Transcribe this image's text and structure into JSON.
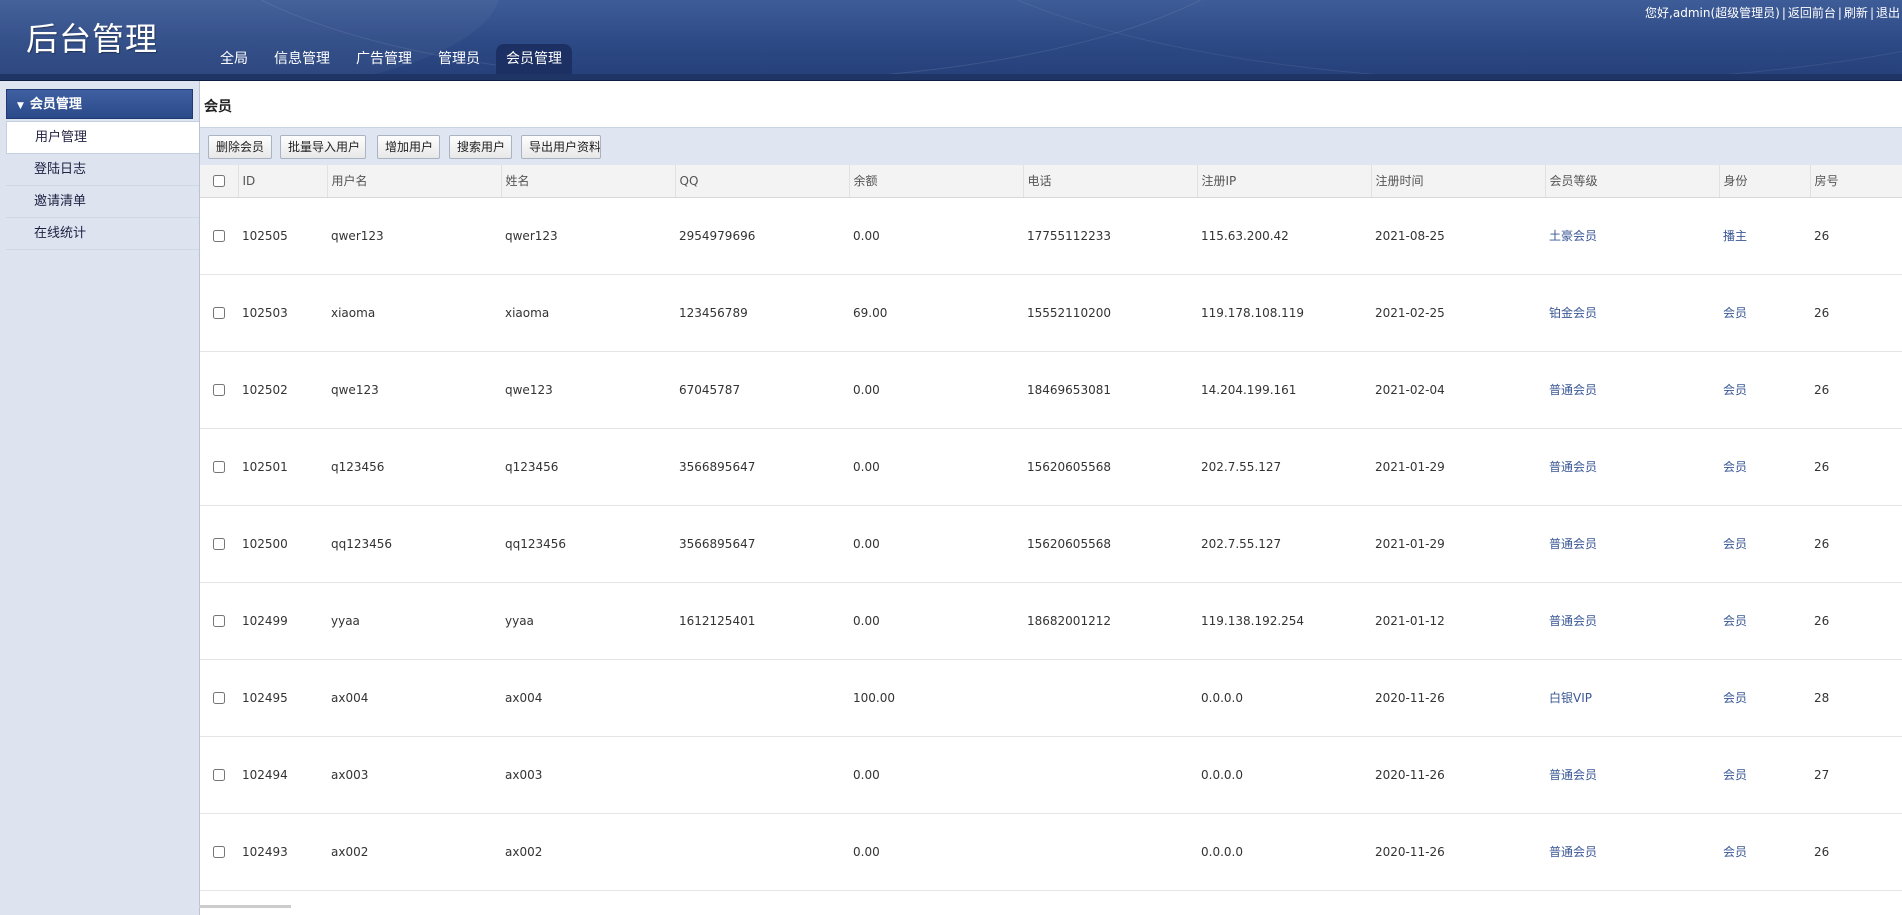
{
  "header": {
    "logo": "后台管理",
    "nav": [
      "全局",
      "信息管理",
      "广告管理",
      "管理员",
      "会员管理"
    ],
    "active_nav": "会员管理",
    "greeting": "您好,admin(超级管理员)",
    "links": [
      "返回前台",
      "刷新",
      "退出"
    ]
  },
  "sidebar": {
    "title": "会员管理",
    "items": [
      "用户管理",
      "登陆日志",
      "邀请清单",
      "在线统计"
    ],
    "active_item": "用户管理"
  },
  "main": {
    "title": "会员",
    "toolbar": [
      "删除会员",
      "批量导入用户",
      "增加用户",
      "搜索用户",
      "导出用户资料"
    ]
  },
  "table": {
    "columns": [
      "ID",
      "用户名",
      "姓名",
      "QQ",
      "余额",
      "电话",
      "注册IP",
      "注册时间",
      "会员等级",
      "身份",
      "房号"
    ],
    "rows": [
      {
        "id": "102505",
        "username": "qwer123",
        "name": "qwer123",
        "qq": "2954979696",
        "balance": "0.00",
        "phone": "17755112233",
        "ip": "115.63.200.42",
        "date": "2021-08-25",
        "level": "土豪会员",
        "role": "播主",
        "room": "26"
      },
      {
        "id": "102503",
        "username": "xiaoma",
        "name": "xiaoma",
        "qq": "123456789",
        "balance": "69.00",
        "phone": "15552110200",
        "ip": "119.178.108.119",
        "date": "2021-02-25",
        "level": "铂金会员",
        "role": "会员",
        "room": "26"
      },
      {
        "id": "102502",
        "username": "qwe123",
        "name": "qwe123",
        "qq": "67045787",
        "balance": "0.00",
        "phone": "18469653081",
        "ip": "14.204.199.161",
        "date": "2021-02-04",
        "level": "普通会员",
        "role": "会员",
        "room": "26"
      },
      {
        "id": "102501",
        "username": "q123456",
        "name": "q123456",
        "qq": "3566895647",
        "balance": "0.00",
        "phone": "15620605568",
        "ip": "202.7.55.127",
        "date": "2021-01-29",
        "level": "普通会员",
        "role": "会员",
        "room": "26"
      },
      {
        "id": "102500",
        "username": "qq123456",
        "name": "qq123456",
        "qq": "3566895647",
        "balance": "0.00",
        "phone": "15620605568",
        "ip": "202.7.55.127",
        "date": "2021-01-29",
        "level": "普通会员",
        "role": "会员",
        "room": "26"
      },
      {
        "id": "102499",
        "username": "yyaa",
        "name": "yyaa",
        "qq": "1612125401",
        "balance": "0.00",
        "phone": "18682001212",
        "ip": "119.138.192.254",
        "date": "2021-01-12",
        "level": "普通会员",
        "role": "会员",
        "room": "26"
      },
      {
        "id": "102495",
        "username": "ax004",
        "name": "ax004",
        "qq": "",
        "balance": "100.00",
        "phone": "",
        "ip": "0.0.0.0",
        "date": "2020-11-26",
        "level": "白银VIP",
        "role": "会员",
        "room": "28"
      },
      {
        "id": "102494",
        "username": "ax003",
        "name": "ax003",
        "qq": "",
        "balance": "0.00",
        "phone": "",
        "ip": "0.0.0.0",
        "date": "2020-11-26",
        "level": "普通会员",
        "role": "会员",
        "room": "27"
      },
      {
        "id": "102493",
        "username": "ax002",
        "name": "ax002",
        "qq": "",
        "balance": "0.00",
        "phone": "",
        "ip": "0.0.0.0",
        "date": "2020-11-26",
        "level": "普通会员",
        "role": "会员",
        "room": "26"
      }
    ]
  }
}
